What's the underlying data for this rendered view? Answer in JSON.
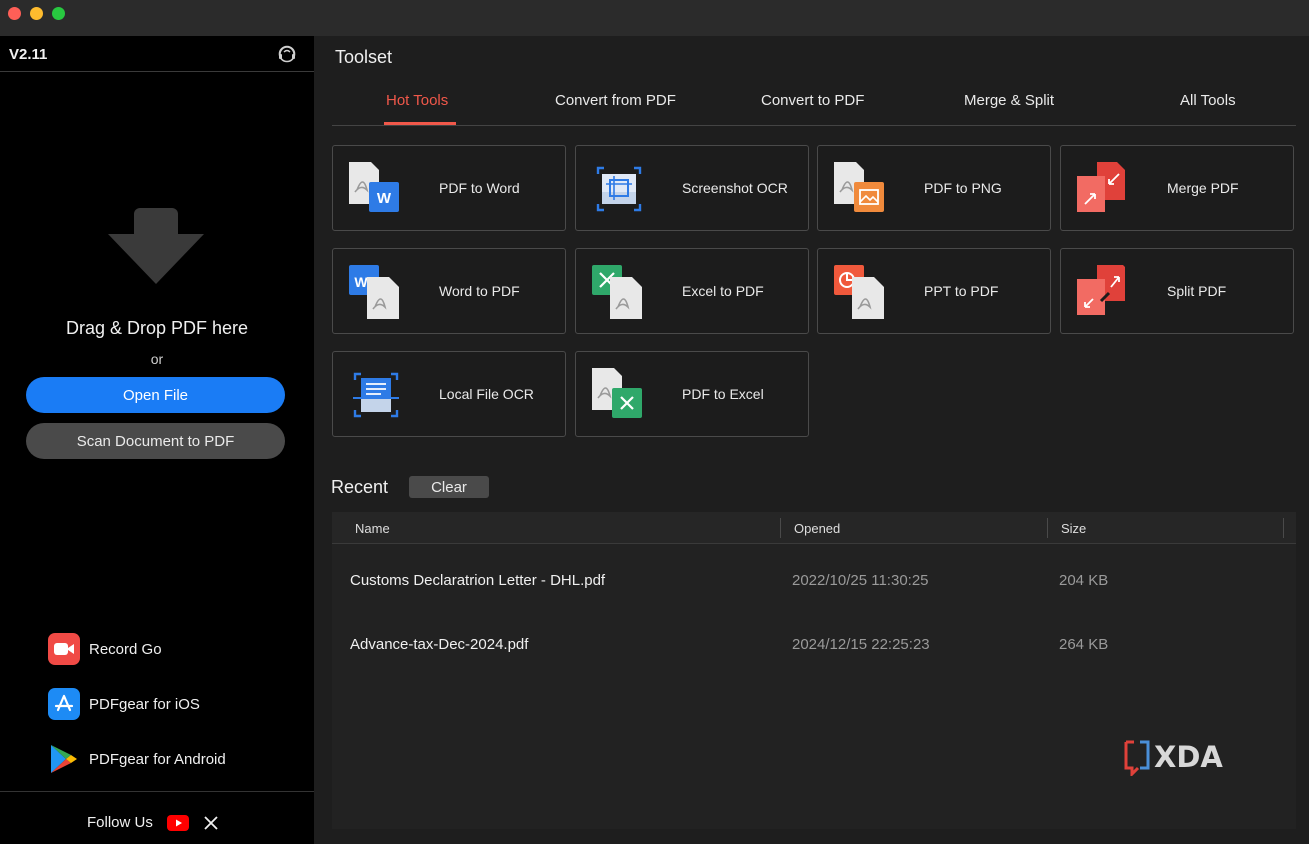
{
  "window": {
    "controls": [
      "close",
      "minimize",
      "zoom"
    ]
  },
  "sidebar": {
    "version": "V2.11",
    "support_icon": "support-headset-icon",
    "drop_text": "Drag & Drop PDF here",
    "or_text": "or",
    "open_button": "Open File",
    "scan_button": "Scan Document to PDF",
    "promos": [
      {
        "label": "Record Go",
        "icon": "record-go-icon"
      },
      {
        "label": "PDFgear for iOS",
        "icon": "app-store-icon"
      },
      {
        "label": "PDFgear for Android",
        "icon": "google-play-icon"
      }
    ],
    "follow_label": "Follow Us"
  },
  "main": {
    "title": "Toolset",
    "tabs": [
      {
        "label": "Hot Tools",
        "active": true
      },
      {
        "label": "Convert from PDF",
        "active": false
      },
      {
        "label": "Convert to PDF",
        "active": false
      },
      {
        "label": "Merge & Split",
        "active": false
      },
      {
        "label": "All Tools",
        "active": false
      }
    ],
    "tools": [
      {
        "label": "PDF to Word",
        "icon": "pdf-to-word-icon"
      },
      {
        "label": "Screenshot OCR",
        "icon": "screenshot-ocr-icon"
      },
      {
        "label": "PDF to PNG",
        "icon": "pdf-to-png-icon"
      },
      {
        "label": "Merge PDF",
        "icon": "merge-pdf-icon"
      },
      {
        "label": "Word to PDF",
        "icon": "word-to-pdf-icon"
      },
      {
        "label": "Excel to PDF",
        "icon": "excel-to-pdf-icon"
      },
      {
        "label": "PPT to PDF",
        "icon": "ppt-to-pdf-icon"
      },
      {
        "label": "Split PDF",
        "icon": "split-pdf-icon"
      },
      {
        "label": "Local File OCR",
        "icon": "local-file-ocr-icon"
      },
      {
        "label": "PDF to Excel",
        "icon": "pdf-to-excel-icon"
      }
    ],
    "recent": {
      "title": "Recent",
      "clear_button": "Clear",
      "columns": [
        "Name",
        "Opened",
        "Size"
      ],
      "rows": [
        {
          "name": "Customs Declaratrion Letter - DHL.pdf",
          "opened": "2022/10/25 11:30:25",
          "size": "204 KB"
        },
        {
          "name": "Advance-tax-Dec-2024.pdf",
          "opened": "2024/12/15 22:25:23",
          "size": "264 KB"
        }
      ]
    }
  },
  "watermark": "XDA",
  "colors": {
    "accent_red": "#f0584a",
    "primary_blue": "#1a7cf5",
    "sidebar_bg": "#000000",
    "main_bg": "#1e1e1e"
  }
}
